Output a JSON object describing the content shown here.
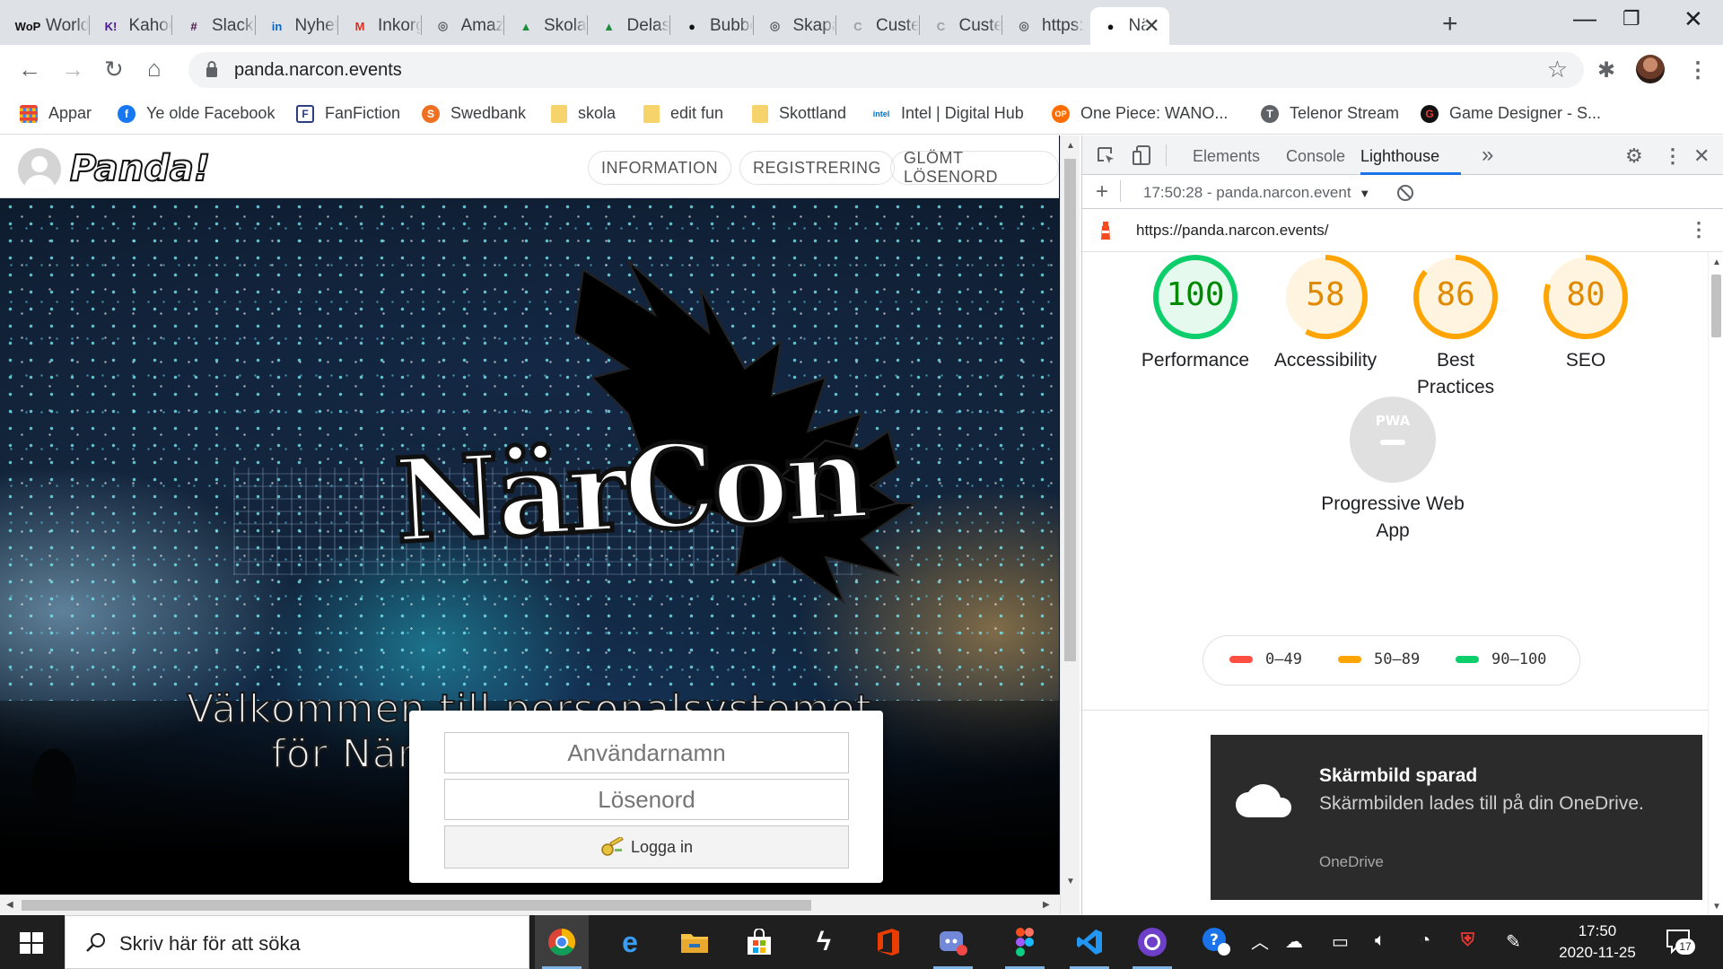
{
  "tabs": [
    {
      "title": "World",
      "icon": "WoP",
      "color": "#111"
    },
    {
      "title": "Kahoo",
      "icon": "K!",
      "color": "#46178f"
    },
    {
      "title": "Slack |",
      "icon": "#",
      "color": "#4a154b"
    },
    {
      "title": "Nyhets",
      "icon": "in",
      "color": "#0a66c2"
    },
    {
      "title": "Inkorg",
      "icon": "M",
      "color": "#d93025"
    },
    {
      "title": "Amazo",
      "icon": "◎",
      "color": "#5f6368"
    },
    {
      "title": "Skolar",
      "icon": "▲",
      "color": "#1e8e3e"
    },
    {
      "title": "Delas",
      "icon": "▲",
      "color": "#1e8e3e"
    },
    {
      "title": "Bubbe",
      "icon": "●",
      "color": "#111"
    },
    {
      "title": "Skapa",
      "icon": "◎",
      "color": "#5f6368"
    },
    {
      "title": "Custell",
      "icon": "C",
      "color": "#9aa0a6"
    },
    {
      "title": "Custell",
      "icon": "C",
      "color": "#9aa0a6"
    },
    {
      "title": "https:/",
      "icon": "◎",
      "color": "#5f6368"
    },
    {
      "title": "Nä",
      "icon": "●",
      "color": "#111"
    }
  ],
  "toolbar": {
    "url": "panda.narcon.events"
  },
  "bookmarks": [
    {
      "label": "Appar",
      "icon": "apps"
    },
    {
      "label": "Ye olde Facebook",
      "icon": "f"
    },
    {
      "label": "FanFiction",
      "icon": "F"
    },
    {
      "label": "Swedbank",
      "icon": "S"
    },
    {
      "label": "skola",
      "icon": "folder"
    },
    {
      "label": "edit fun",
      "icon": "folder"
    },
    {
      "label": "Skottland",
      "icon": "folder"
    },
    {
      "label": "Intel | Digital Hub",
      "icon": "intel"
    },
    {
      "label": "One Piece: WANO...",
      "icon": "OP"
    },
    {
      "label": "Telenor Stream",
      "icon": "T"
    },
    {
      "label": "Game Designer - S...",
      "icon": "G"
    }
  ],
  "site": {
    "logo": "Panda!",
    "nav": [
      "INFORMATION",
      "REGISTRERING",
      "GLÖMT LÖSENORD"
    ],
    "brand": "NärCon",
    "welcome_line1": "Välkommen till personalsystemet",
    "welcome_line2": "för NärCons evenemang!",
    "login": {
      "username_placeholder": "Användarnamn",
      "password_placeholder": "Lösenord",
      "button": "Logga in"
    }
  },
  "devtools": {
    "tabs": [
      "Elements",
      "Console",
      "Lighthouse"
    ],
    "active_tab": "Lighthouse",
    "report_select": "17:50:28 - panda.narcon.event",
    "report_url": "https://panda.narcon.events/",
    "scores": [
      {
        "label": "Performance",
        "value": 100,
        "color": "#0cce6b"
      },
      {
        "label": "Accessibility",
        "value": 58,
        "color": "#ffa400"
      },
      {
        "label": "Best Practices",
        "value": 86,
        "color": "#ffa400"
      },
      {
        "label": "SEO",
        "value": 80,
        "color": "#ffa400"
      }
    ],
    "pwa": {
      "badge": "PWA",
      "label": "Progressive Web App"
    },
    "legend": [
      {
        "range": "0–49",
        "color": "#ff4e42"
      },
      {
        "range": "50–89",
        "color": "#ffa400"
      },
      {
        "range": "90–100",
        "color": "#0cce6b"
      }
    ]
  },
  "toast": {
    "title": "Skärmbild sparad",
    "body": "Skärmbilden lades till på din OneDrive.",
    "source": "OneDrive"
  },
  "taskbar": {
    "search_placeholder": "Skriv här för att söka",
    "time": "17:50",
    "date": "2020-11-25",
    "notification_count": "17"
  }
}
